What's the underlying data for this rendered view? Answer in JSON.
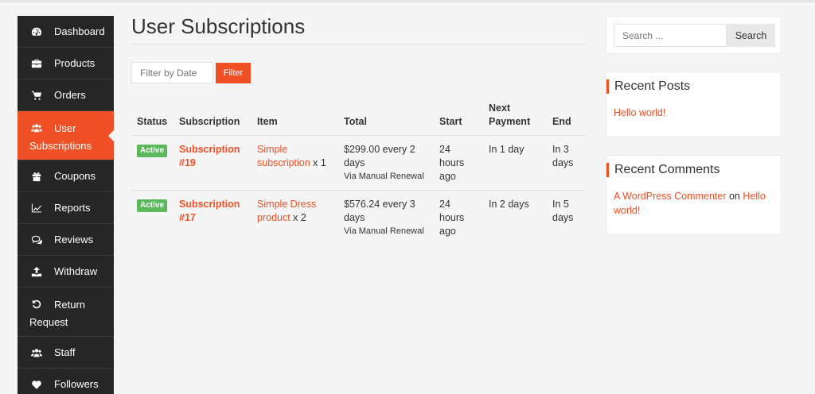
{
  "sidebar": {
    "items": [
      {
        "label": "Dashboard",
        "icon": "dashboard-icon"
      },
      {
        "label": "Products",
        "icon": "briefcase-icon"
      },
      {
        "label": "Orders",
        "icon": "cart-icon"
      },
      {
        "label": "User Subscriptions",
        "icon": "users-icon"
      },
      {
        "label": "Coupons",
        "icon": "gift-icon"
      },
      {
        "label": "Reports",
        "icon": "line-chart-icon"
      },
      {
        "label": "Reviews",
        "icon": "comments-icon"
      },
      {
        "label": "Withdraw",
        "icon": "upload-icon"
      },
      {
        "label": "Return Request",
        "icon": "undo-icon"
      },
      {
        "label": "Staff",
        "icon": "users-icon"
      },
      {
        "label": "Followers",
        "icon": "heart-icon"
      }
    ],
    "active_index": 3
  },
  "main": {
    "title": "User Subscriptions",
    "filter_placeholder": "Filter by Date",
    "filter_button": "Filter",
    "columns": [
      "Status",
      "Subscription",
      "Item",
      "Total",
      "Start",
      "Next Payment",
      "End"
    ],
    "rows": [
      {
        "status": "Active",
        "subscription": "Subscription #19",
        "item_link": "Simple subscription",
        "item_qty": " x 1",
        "total": "$299.00 every 2 days",
        "total_via": "Via Manual Renewal",
        "start": "24 hours ago",
        "next_payment": "In 1 day",
        "end": "In 3 days"
      },
      {
        "status": "Active",
        "subscription": "Subscription #17",
        "item_link": "Simple Dress product",
        "item_qty": " x 2",
        "total": "$576.24 every 3 days",
        "total_via": "Via Manual Renewal",
        "start": "24 hours ago",
        "next_payment": "In 2 days",
        "end": "In 5 days"
      }
    ]
  },
  "search": {
    "placeholder": "Search ...",
    "button": "Search"
  },
  "recent_posts": {
    "title": "Recent Posts",
    "items": [
      "Hello world!"
    ]
  },
  "recent_comments": {
    "title": "Recent Comments",
    "author": "A WordPress Commenter",
    "on_text": " on ",
    "post": "Hello world!"
  },
  "colors": {
    "accent": "#f05025",
    "sidebar_bg": "#262626",
    "badge_active": "#5cb85c"
  }
}
